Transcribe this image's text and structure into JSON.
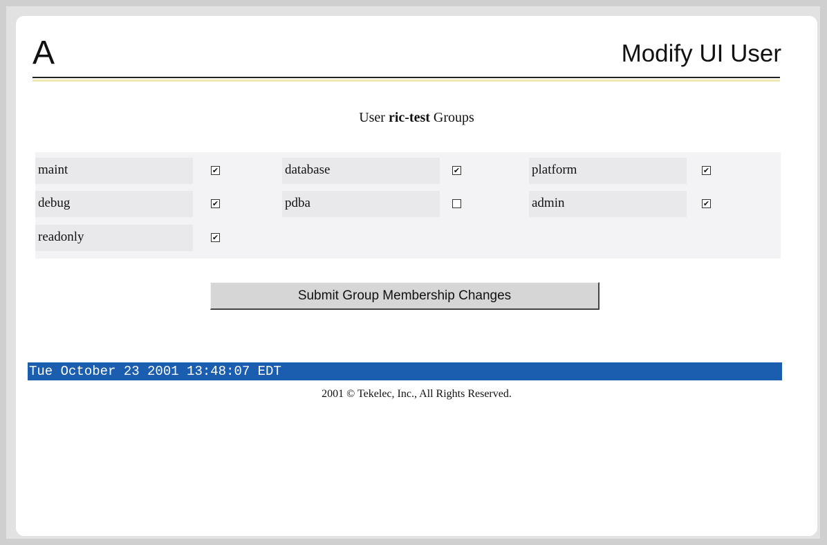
{
  "header": {
    "logo": "A",
    "title": "Modify UI User"
  },
  "subtitle": {
    "prefix": "User",
    "username": "ric-test",
    "suffix": "Groups"
  },
  "groups": [
    {
      "name": "maint",
      "checked": true
    },
    {
      "name": "database",
      "checked": true
    },
    {
      "name": "platform",
      "checked": true
    },
    {
      "name": "debug",
      "checked": true
    },
    {
      "name": "pdba",
      "checked": false
    },
    {
      "name": "admin",
      "checked": true
    },
    {
      "name": "readonly",
      "checked": true
    }
  ],
  "submit_label": "Submit Group Membership Changes",
  "status": {
    "timestamp": "Tue October 23 2001 13:48:07 EDT"
  },
  "footer": {
    "copyright": "2001 © Tekelec, Inc., All Rights Reserved."
  }
}
